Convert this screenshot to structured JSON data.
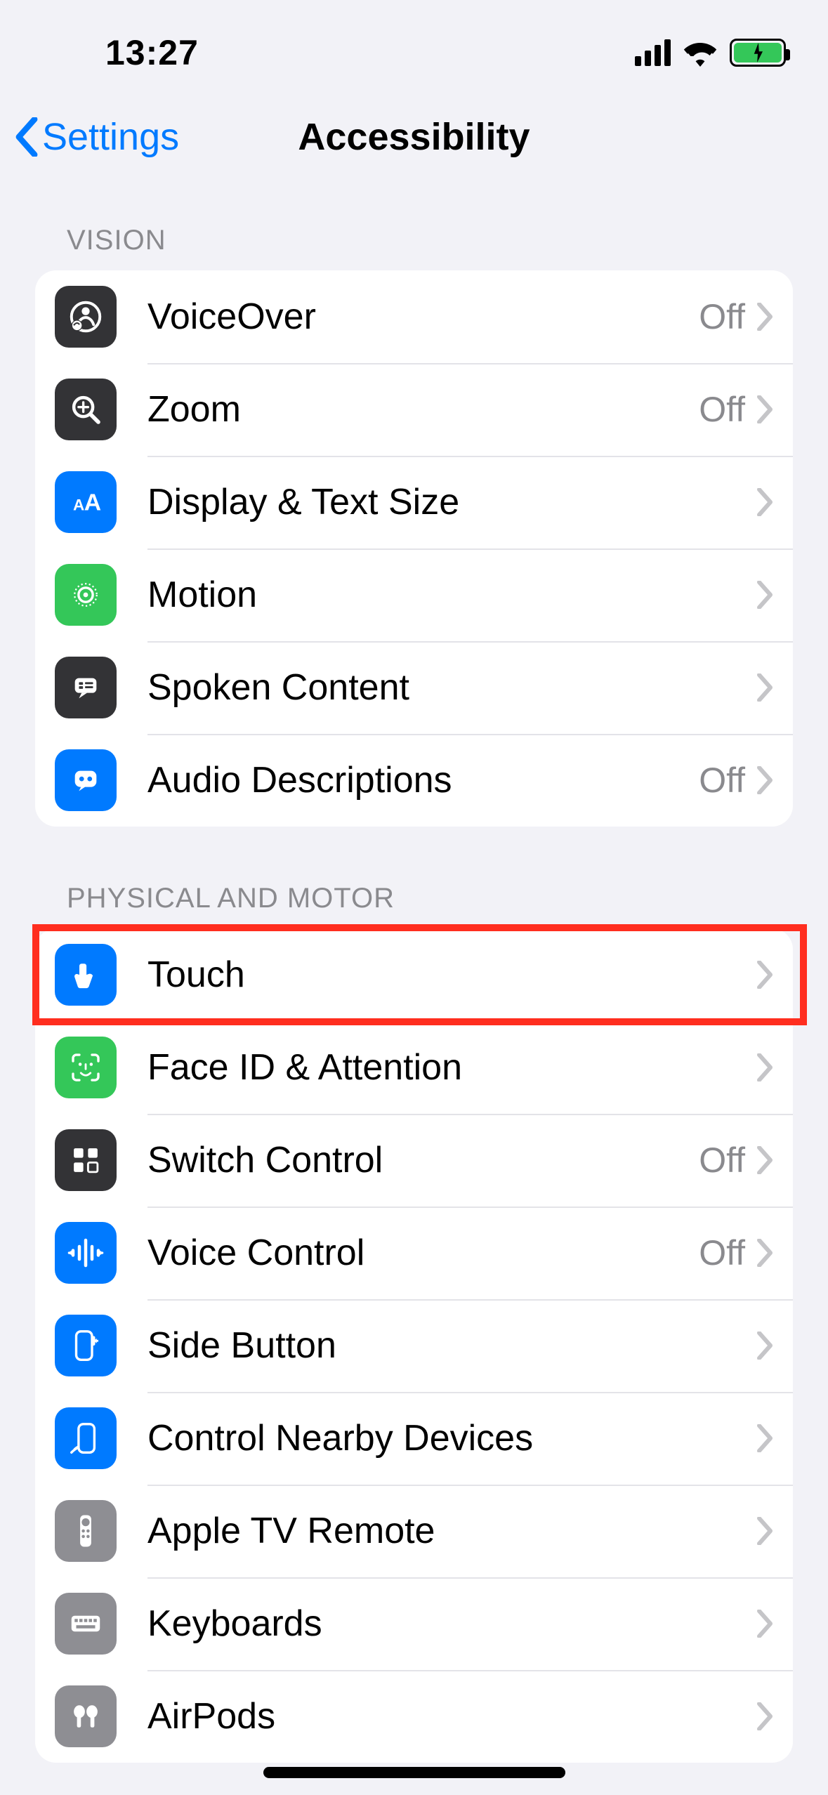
{
  "status": {
    "time": "13:27"
  },
  "nav": {
    "back_label": "Settings",
    "title": "Accessibility"
  },
  "sections": {
    "vision": {
      "header": "Vision",
      "items": {
        "voiceover": {
          "label": "VoiceOver",
          "value": "Off"
        },
        "zoom": {
          "label": "Zoom",
          "value": "Off"
        },
        "display_text_size": {
          "label": "Display & Text Size"
        },
        "motion": {
          "label": "Motion"
        },
        "spoken_content": {
          "label": "Spoken Content"
        },
        "audio_descriptions": {
          "label": "Audio Descriptions",
          "value": "Off"
        }
      }
    },
    "physical_motor": {
      "header": "Physical and Motor",
      "items": {
        "touch": {
          "label": "Touch"
        },
        "face_id_attention": {
          "label": "Face ID & Attention"
        },
        "switch_control": {
          "label": "Switch Control",
          "value": "Off"
        },
        "voice_control": {
          "label": "Voice Control",
          "value": "Off"
        },
        "side_button": {
          "label": "Side Button"
        },
        "control_nearby": {
          "label": "Control Nearby Devices"
        },
        "apple_tv_remote": {
          "label": "Apple TV Remote"
        },
        "keyboards": {
          "label": "Keyboards"
        },
        "airpods": {
          "label": "AirPods"
        }
      }
    }
  }
}
